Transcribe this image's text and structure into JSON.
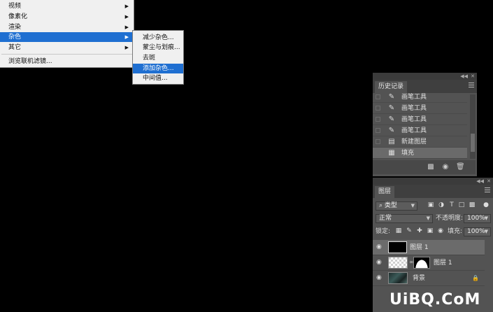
{
  "filter_menu": {
    "items": [
      {
        "label": "视频",
        "has_submenu": true
      },
      {
        "label": "像素化",
        "has_submenu": true
      },
      {
        "label": "渲染",
        "has_submenu": true
      },
      {
        "label": "杂色",
        "has_submenu": true,
        "active": true
      },
      {
        "label": "其它",
        "has_submenu": true
      }
    ],
    "browse_online": "浏览联机滤镜...",
    "noise_submenu": [
      {
        "label": "减少杂色..."
      },
      {
        "label": "蒙尘与划痕..."
      },
      {
        "label": "去斑"
      },
      {
        "label": "添加杂色...",
        "active": true
      },
      {
        "label": "中间值..."
      }
    ]
  },
  "history_panel": {
    "title": "历史记录",
    "states": [
      {
        "label": "画笔工具",
        "icon": "brush-icon"
      },
      {
        "label": "画笔工具",
        "icon": "brush-icon"
      },
      {
        "label": "画笔工具",
        "icon": "brush-icon"
      },
      {
        "label": "画笔工具",
        "icon": "brush-icon"
      },
      {
        "label": "新建图层",
        "icon": "new-layer-icon"
      },
      {
        "label": "填充",
        "icon": "fill-icon",
        "selected": true
      }
    ],
    "footer_icons": [
      "new-document-from-state-icon",
      "snapshot-camera-icon",
      "trash-icon"
    ]
  },
  "layers_panel": {
    "title": "图层",
    "filter_kind": "类型",
    "blend_mode": "正常",
    "opacity_label": "不透明度:",
    "opacity_value": "100%",
    "lock_label": "锁定:",
    "fill_label": "填充:",
    "fill_value": "100%",
    "layers": [
      {
        "name": "图层 1",
        "thumb": "black",
        "selected": true
      },
      {
        "name": "图层 1",
        "thumb": "transparent-with-mask"
      },
      {
        "name": "背景",
        "thumb": "photo",
        "locked": true
      }
    ]
  },
  "watermark": "UiBQ.CoM",
  "colors": {
    "menu_bg": "#f0f0f0",
    "menu_highlight": "#1f6fd1",
    "panel_bg": "#535353",
    "canvas_bg": "#000000"
  }
}
